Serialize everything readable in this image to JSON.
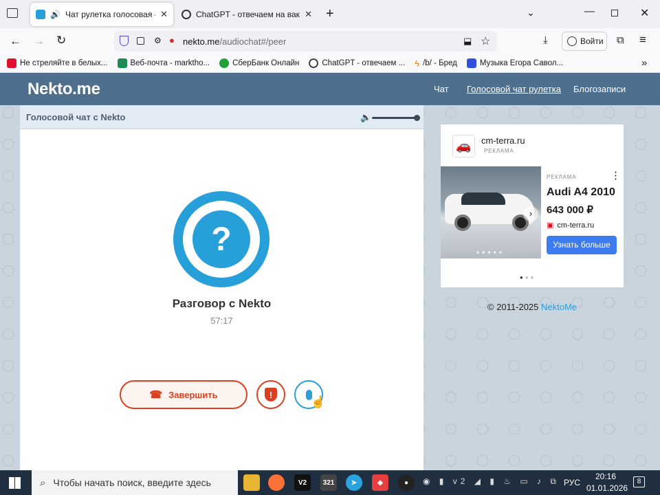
{
  "browser": {
    "tabs": [
      {
        "title": "Чат рулетка голосовая — Н",
        "active": true
      },
      {
        "title": "ChatGPT - отвечаем на ваканс",
        "active": false
      }
    ],
    "url_host": "nekto.me",
    "url_path": "/audiochat#/peer",
    "sign_in_label": "Войти",
    "bookmarks": [
      {
        "label": "Не стреляйте в белых...",
        "color": "#e01030"
      },
      {
        "label": "Веб-почта - marktho...",
        "color": "#1e8a55"
      },
      {
        "label": "СберБанк Онлайн",
        "color": "#21a038"
      },
      {
        "label": "ChatGPT - отвечаем ...",
        "color": "#444444"
      },
      {
        "label": "/b/ - Бред",
        "color": "#f08020"
      },
      {
        "label": "Музыка Егора Савол...",
        "color": "#3050e0"
      }
    ]
  },
  "site": {
    "logo": "Nekto.me",
    "nav": [
      "Чат",
      "Голосовой чат рулетка",
      "Блогозаписи"
    ],
    "panel_title": "Голосовой чат с Nekto",
    "volume_level": 1.0,
    "peer_name": "Разговор с Nekto",
    "timer": "57:17",
    "end_button_label": "Завершить",
    "copyright": "© 2011-2025 ",
    "copyright_link": "NektoMe"
  },
  "ad": {
    "advertiser": "cm-terra.ru",
    "advertiser_tag": "РЕКЛАМА",
    "card_tag": "РЕКЛАМА",
    "title": "Audi A4 2010",
    "price": "643 000 ₽",
    "domain": "cm-terra.ru",
    "cta": "Узнать больше"
  },
  "taskbar": {
    "search_placeholder": "Чтобы начать поиск, введите здесь",
    "language": "РУС",
    "time": "20:16",
    "date": "01.01.2026",
    "notifications": "8"
  },
  "colors": {
    "accent": "#279fd8",
    "end": "#d9401f",
    "header": "#4f6f8f"
  }
}
